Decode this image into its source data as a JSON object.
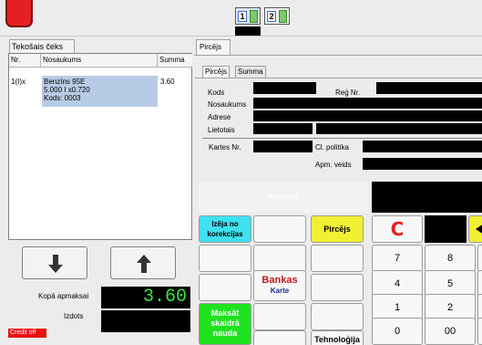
{
  "toolbar": {
    "pos_1": "1",
    "pos_2": "2"
  },
  "receipt": {
    "tab_label": "Tekošais čeks",
    "columns": [
      "Nr.",
      "Nosaukums",
      "Summa"
    ],
    "rows": [
      {
        "nr": "1(I)x",
        "name_line1": "Benzīns 95E",
        "name_line2": "5.000 I x0.720",
        "name_line3": "Kods: 0003",
        "sum": "3.60"
      }
    ]
  },
  "totals": {
    "total_label": "Kopā apmaksai",
    "total_value": "3.60",
    "change_label": "Izdots",
    "credit_off": "Credit off"
  },
  "customer": {
    "tab_label": "Pircējs",
    "subtabs": [
      "Pircējs",
      "Summa"
    ],
    "fields": {
      "code": "Kods",
      "reg_nr": "Reģ Nr.",
      "name": "Nosaukums",
      "address": "Adrese",
      "user": "Lietotais",
      "card_nr": "Kartes Nr.",
      "cl_policy": "Cl. politika",
      "payment_type": "Apm. veids"
    }
  },
  "keypad": {
    "korekcija": "Korekcija",
    "exit_correction": "Izēja no korekcijas",
    "buyer": "Pircējs",
    "clear": "C",
    "bank_card_line1": "Bankas",
    "bank_card_line2": "Karte",
    "cash_pay": "Maksāt skaidrā nauda",
    "technology": "Tehnoloģija",
    "digits": [
      "7",
      "8",
      "4",
      "5",
      "1",
      "2",
      "0",
      "00"
    ]
  },
  "colors": {
    "accent_red": "#e62020",
    "display_green": "#39e639",
    "cyan_button": "#3fe0f0",
    "yellow_button": "#f2f032",
    "green_button": "#1fe21f",
    "selection_blue": "#b8cbe6"
  },
  "icons": {
    "arrow_down": "arrow-down-icon",
    "arrow_up": "arrow-up-icon",
    "arrow_left": "arrow-left-icon"
  }
}
